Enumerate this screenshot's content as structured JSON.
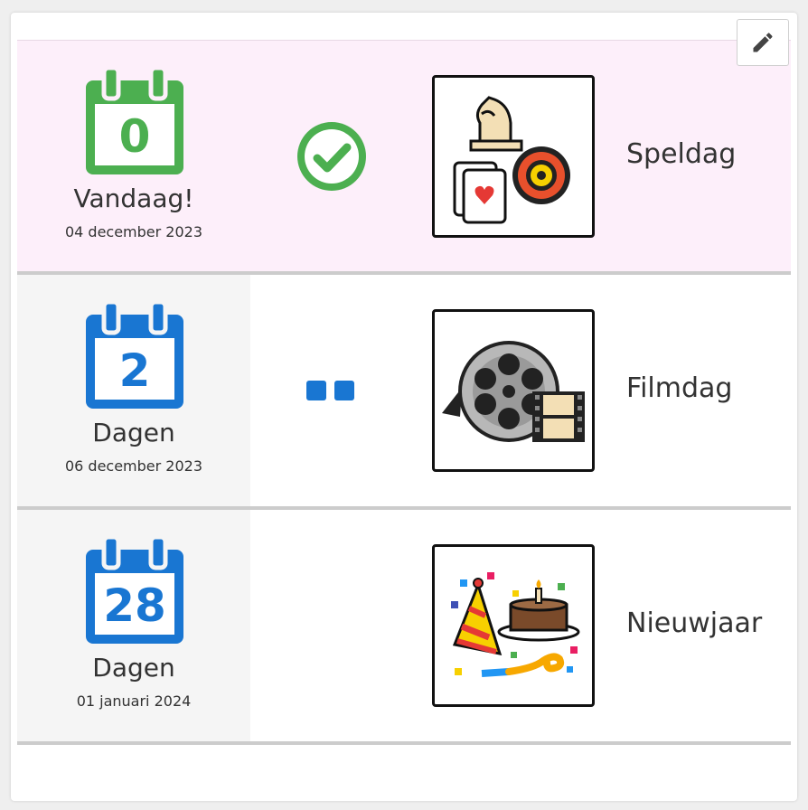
{
  "colors": {
    "today": "#4caf50",
    "future": "#1976d2",
    "today_bg": "#fdeffa"
  },
  "toolbar": {
    "edit_icon": "pencil-icon"
  },
  "events": [
    {
      "days": "0",
      "label": "Vandaag!",
      "date": "04 december 2023",
      "status": "check-circle-icon",
      "title": "Speldag",
      "picto": "games-picto"
    },
    {
      "days": "2",
      "label": "Dagen",
      "date": "06 december 2023",
      "status": "two-squares-icon",
      "title": "Filmdag",
      "picto": "film-reel-picto"
    },
    {
      "days": "28",
      "label": "Dagen",
      "date": "01 januari 2024",
      "status": "",
      "title": "Nieuwjaar",
      "picto": "party-picto"
    }
  ]
}
